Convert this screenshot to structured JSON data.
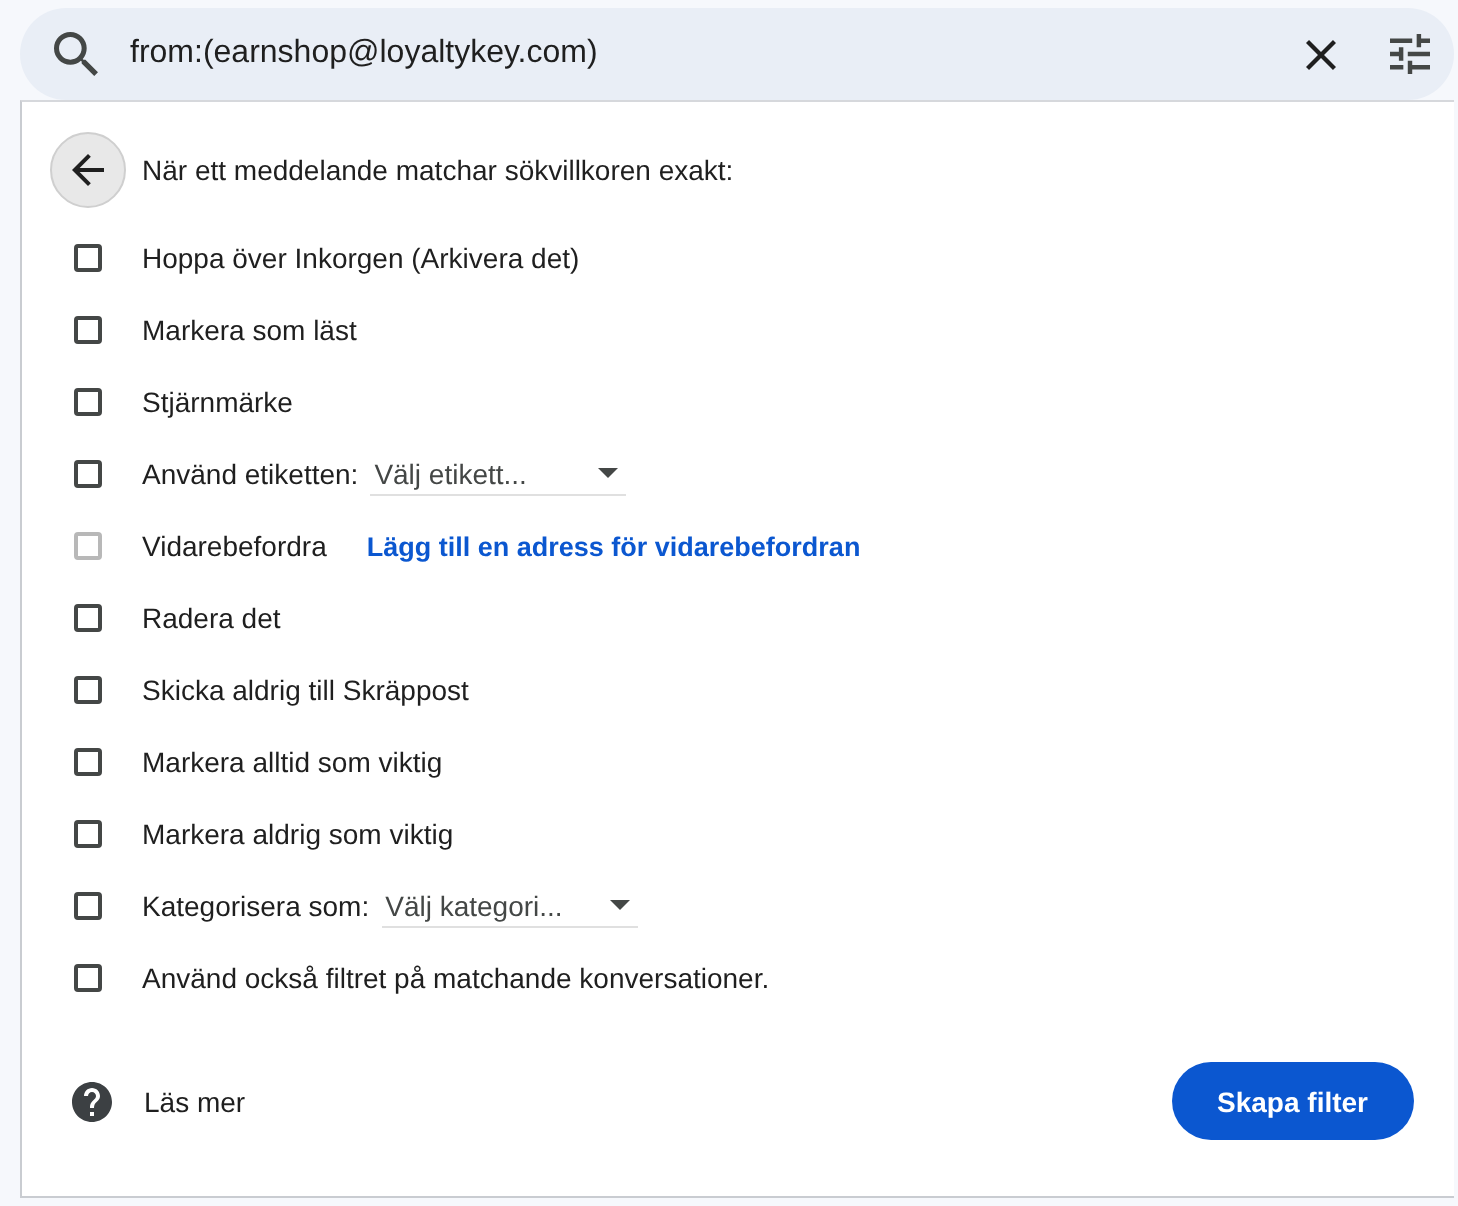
{
  "search": {
    "value": "from:(earnshop@loyaltykey.com)"
  },
  "header": {
    "text": "När ett meddelande matchar sökvillkoren exakt:"
  },
  "options": [
    {
      "kind": "plain",
      "label": "Hoppa över Inkorgen (Arkivera det)",
      "checked": false,
      "disabled": false
    },
    {
      "kind": "plain",
      "label": "Markera som läst",
      "checked": false,
      "disabled": false
    },
    {
      "kind": "plain",
      "label": "Stjärnmärke",
      "checked": false,
      "disabled": false
    },
    {
      "kind": "select",
      "label": "Använd etiketten:",
      "checked": false,
      "disabled": false,
      "select": "Välj etikett..."
    },
    {
      "kind": "link",
      "label": "Vidarebefordra",
      "checked": false,
      "disabled": true,
      "link": "Lägg till en adress för vidarebefordran"
    },
    {
      "kind": "plain",
      "label": "Radera det",
      "checked": false,
      "disabled": false
    },
    {
      "kind": "plain",
      "label": "Skicka aldrig till Skräppost",
      "checked": false,
      "disabled": false
    },
    {
      "kind": "plain",
      "label": "Markera alltid som viktig",
      "checked": false,
      "disabled": false
    },
    {
      "kind": "plain",
      "label": "Markera aldrig som viktig",
      "checked": false,
      "disabled": false
    },
    {
      "kind": "select",
      "label": "Kategorisera som:",
      "checked": false,
      "disabled": false,
      "select": "Välj kategori..."
    },
    {
      "kind": "plain",
      "label": "Använd också filtret på matchande konversationer.",
      "checked": false,
      "disabled": false
    }
  ],
  "footer": {
    "help": "Läs mer",
    "button": "Skapa filter"
  }
}
